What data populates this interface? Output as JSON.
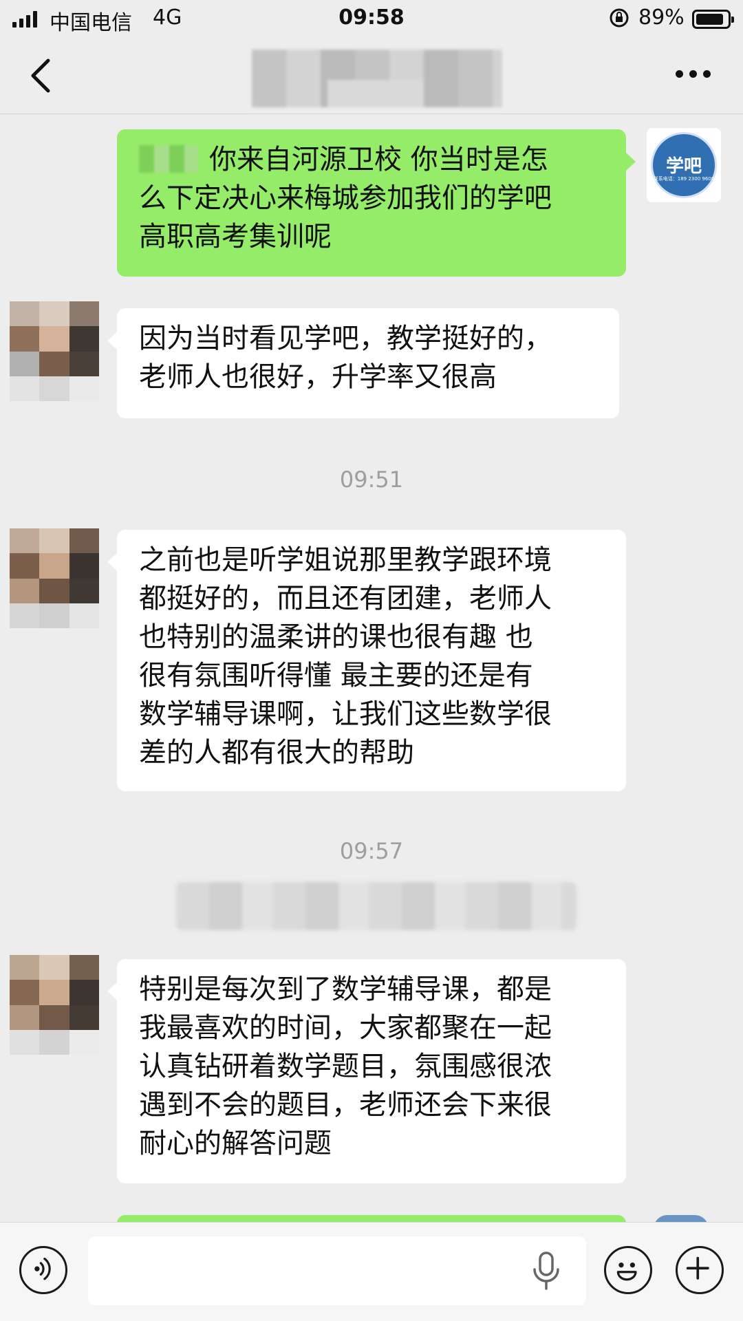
{
  "status_bar": {
    "carrier": "中国电信",
    "network": "4G",
    "time": "09:58",
    "battery_percent": "89%",
    "battery_level": 0.89
  },
  "nav": {
    "back_icon": "chevron-left-icon",
    "more_icon": "more-dots-icon"
  },
  "messages": [
    {
      "side": "right",
      "lines": [
        "你来自河源卫校 你当时是怎",
        "么下定决心来梅城参加我们的学吧",
        "高职高考集训呢"
      ]
    },
    {
      "side": "left",
      "lines": [
        "因为当时看见学吧，教学挺好的，",
        "老师人也很好，升学率又很高"
      ]
    },
    {
      "side": "left",
      "lines": [
        "之前也是听学姐说那里教学跟环境",
        "都挺好的，而且还有团建，老师人",
        "也特别的温柔讲的课也很有趣 也",
        "很有氛围听得懂 最主要的还是有",
        "数学辅导课啊，让我们这些数学很",
        "差的人都有很大的帮助"
      ]
    },
    {
      "side": "left",
      "lines": [
        "特别是每次到了数学辅导课，都是",
        "我最喜欢的时间，大家都聚在一起",
        "认真钻研着数学题目，氛围感很浓",
        "遇到不会的题目，老师还会下来很",
        "耐心的解答问题"
      ]
    }
  ],
  "timestamps": [
    "09:51",
    "09:57"
  ],
  "self_avatar": {
    "brand": "学吧",
    "sub": "联系电话：189 2300 9600",
    "color": "#2f6fb2"
  },
  "input_bar": {
    "voice_icon": "voice-icon",
    "mic_icon": "microphone-icon",
    "emoji_icon": "emoji-icon",
    "plus_icon": "plus-icon"
  },
  "colors": {
    "background": "#ededed",
    "bubble_self": "#95ec69",
    "bubble_other": "#ffffff"
  }
}
